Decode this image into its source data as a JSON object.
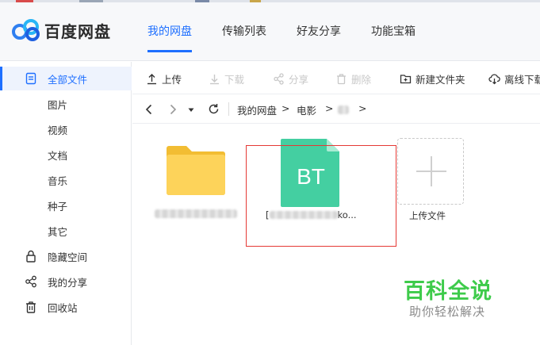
{
  "app": {
    "name": "百度网盘",
    "brand_color": "#1e6fff"
  },
  "nav": {
    "items": [
      {
        "label": "我的网盘",
        "active": true
      },
      {
        "label": "传输列表"
      },
      {
        "label": "好友分享"
      },
      {
        "label": "功能宝箱"
      }
    ]
  },
  "sidebar": {
    "items": [
      {
        "label": "全部文件",
        "icon": "document-icon",
        "active": true
      },
      {
        "label": "图片"
      },
      {
        "label": "视频"
      },
      {
        "label": "文档"
      },
      {
        "label": "音乐"
      },
      {
        "label": "种子"
      },
      {
        "label": "其它"
      },
      {
        "label": "隐藏空间",
        "icon": "lock-icon"
      },
      {
        "label": "我的分享",
        "icon": "share-icon"
      },
      {
        "label": "回收站",
        "icon": "trash-icon"
      }
    ]
  },
  "toolbar": {
    "upload": "上传",
    "download": "下载",
    "share": "分享",
    "delete": "删除",
    "new_folder": "新建文件夹",
    "offline_download": "离线下载"
  },
  "path": {
    "root": "我的网盘",
    "folder": "电影",
    "separator": ">"
  },
  "files": {
    "bt_badge": "BT",
    "bt_name_prefix": "[",
    "bt_name_suffix": "ko...",
    "upload_label": "上传文件",
    "folder_color": "#fdd35a",
    "bt_color": "#44cfa1"
  },
  "watermark": {
    "title": "百科全说",
    "subtitle": "助你轻松解决"
  }
}
